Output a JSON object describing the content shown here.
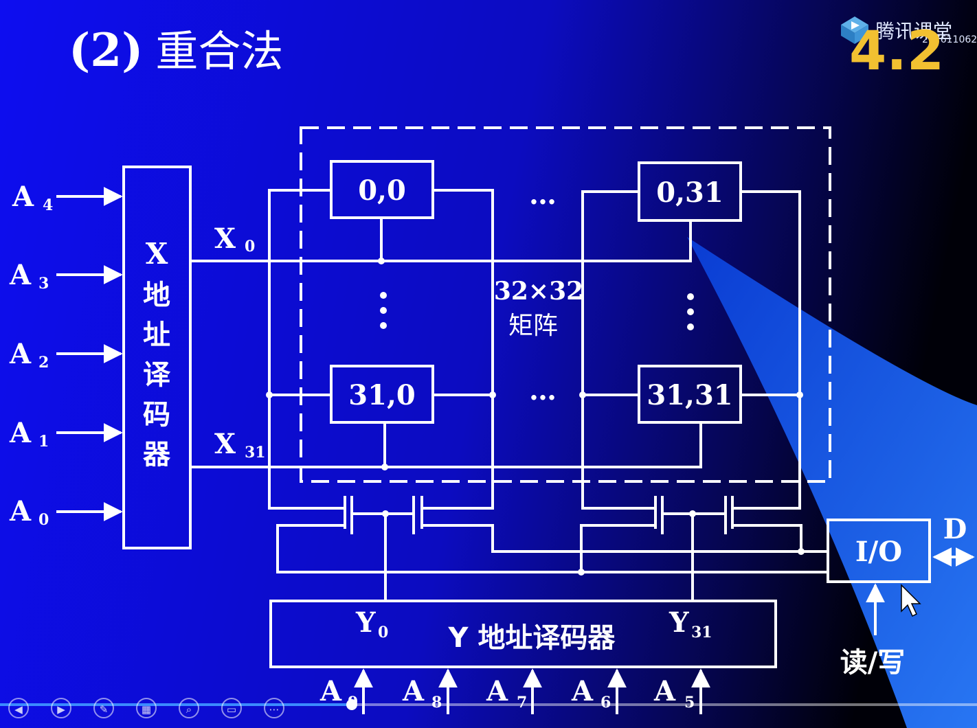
{
  "slide": {
    "title_num": "(2)",
    "title_text": "重合法"
  },
  "brand": {
    "name": "腾讯课堂",
    "id": "277611062",
    "version": "4.2"
  },
  "diagram": {
    "x_inputs": [
      {
        "letter": "A",
        "sub": "4"
      },
      {
        "letter": "A",
        "sub": "3"
      },
      {
        "letter": "A",
        "sub": "2"
      },
      {
        "letter": "A",
        "sub": "1"
      },
      {
        "letter": "A",
        "sub": "0"
      }
    ],
    "x_decoder_label": [
      "X",
      "地",
      "址",
      "译",
      "码",
      "器"
    ],
    "x_lines": [
      {
        "letter": "X",
        "sub": "0"
      },
      {
        "letter": "X",
        "sub": "31"
      }
    ],
    "cells": [
      "0,0",
      "0,31",
      "31,0",
      "31,31"
    ],
    "ellipsis": "…",
    "matrix_size": "32×32",
    "matrix_label": "矩阵",
    "y_decoder_label": "Y 地址译码器",
    "y_lines": [
      {
        "letter": "Y",
        "sub": "0"
      },
      {
        "letter": "Y",
        "sub": "31"
      }
    ],
    "y_inputs": [
      {
        "letter": "A",
        "sub": "9"
      },
      {
        "letter": "A",
        "sub": "8"
      },
      {
        "letter": "A",
        "sub": "7"
      },
      {
        "letter": "A",
        "sub": "6"
      },
      {
        "letter": "A",
        "sub": "5"
      }
    ],
    "io_label": "I/O",
    "data_label": "D",
    "rw_label": "读/写"
  },
  "player": {
    "progress_percent": 36,
    "buttons": [
      "prev-icon",
      "play-icon",
      "pen-icon",
      "layout-icon",
      "zoom-icon",
      "chat-icon",
      "more-icon"
    ]
  },
  "colors": {
    "background": "#0a0aa0",
    "line": "#ffffff",
    "accent": "#f2c031"
  }
}
